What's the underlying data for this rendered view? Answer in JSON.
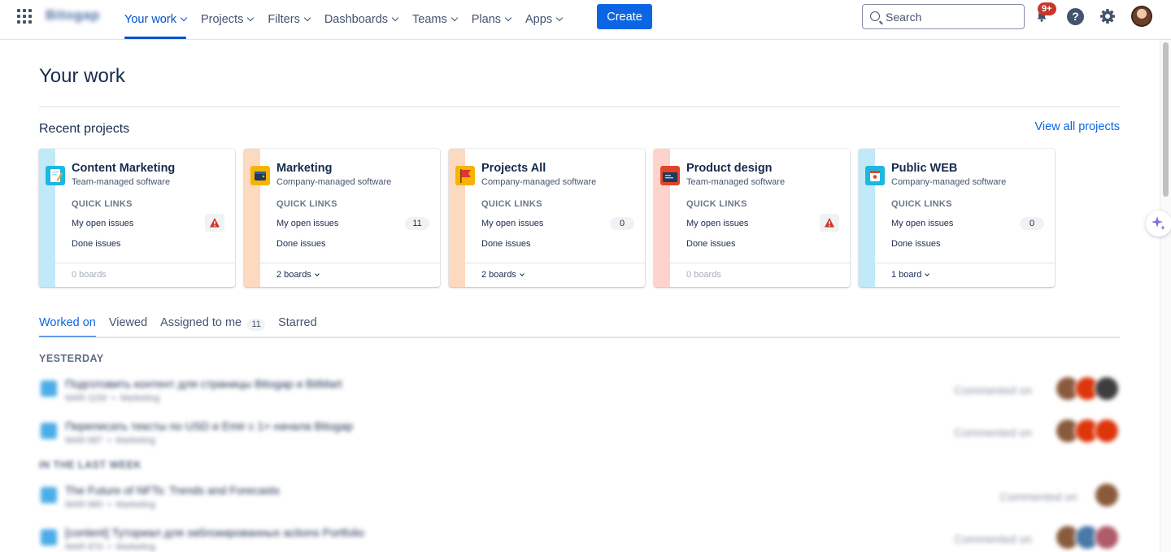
{
  "nav": {
    "logo": "Bitogap",
    "items": [
      {
        "label": "Your work",
        "active": true
      },
      {
        "label": "Projects",
        "active": false
      },
      {
        "label": "Filters",
        "active": false
      },
      {
        "label": "Dashboards",
        "active": false
      },
      {
        "label": "Teams",
        "active": false
      },
      {
        "label": "Plans",
        "active": false
      },
      {
        "label": "Apps",
        "active": false
      }
    ],
    "create_label": "Create",
    "search_placeholder": "Search",
    "notification_badge": "9+",
    "help_label": "?",
    "accent_color": "#0c66e4"
  },
  "main": {
    "title": "Your work",
    "recent_projects": {
      "heading": "Recent projects",
      "view_all": "View all projects",
      "quick_links_label": "QUICK LINKS",
      "my_open_issues_label": "My open issues",
      "done_issues_label": "Done issues",
      "cards": [
        {
          "name": "Content Marketing",
          "type": "Team-managed software",
          "open_issues": "",
          "warning": true,
          "boards": "0 boards",
          "boards_clickable": false,
          "strip_color": "#c1e9f8",
          "icon": "pencil-note-icon"
        },
        {
          "name": "Marketing",
          "type": "Company-managed software",
          "open_issues": "11",
          "warning": false,
          "boards": "2 boards",
          "boards_clickable": true,
          "strip_color": "#fdd9c0",
          "icon": "wallet-icon"
        },
        {
          "name": "Projects All",
          "type": "Company-managed software",
          "open_issues": "0",
          "warning": false,
          "boards": "2 boards",
          "boards_clickable": true,
          "strip_color": "#fdd9c0",
          "icon": "flag-icon"
        },
        {
          "name": "Product design",
          "type": "Team-managed software",
          "open_issues": "",
          "warning": true,
          "boards": "0 boards",
          "boards_clickable": false,
          "strip_color": "#fdd3cc",
          "icon": "code-window-icon"
        },
        {
          "name": "Public WEB",
          "type": "Company-managed software",
          "open_issues": "0",
          "warning": false,
          "boards": "1 board",
          "boards_clickable": true,
          "strip_color": "#c1e9f8",
          "icon": "cup-icon"
        }
      ]
    },
    "tabs": [
      {
        "label": "Worked on",
        "active": true,
        "count": ""
      },
      {
        "label": "Viewed",
        "active": false,
        "count": ""
      },
      {
        "label": "Assigned to me",
        "active": false,
        "count": "11"
      },
      {
        "label": "Starred",
        "active": false,
        "count": ""
      }
    ],
    "activity": {
      "yesterday_label": "YESTERDAY",
      "last_week_label": "IN THE LAST WEEK",
      "yesterday": [
        {
          "title": "Подготовить контент для страницы Bitogap и BitMart",
          "key": "MAR-1150",
          "project": "Marketing",
          "action": "Commented on"
        },
        {
          "title": "Переписать тексты по USD и Emir с 1+ начала Bitogap",
          "key": "MAR-987",
          "project": "Marketing",
          "action": "Commented on"
        }
      ],
      "last_week": [
        {
          "title": "The Future of NFTs: Trends and Forecasts",
          "key": "MAR-980",
          "project": "Marketing",
          "action": "Commented on"
        },
        {
          "title": "[content] Туториал для заблокированных actions Portfolio",
          "key": "MAR-970",
          "project": "Marketing",
          "action": "Commented on"
        }
      ]
    }
  }
}
